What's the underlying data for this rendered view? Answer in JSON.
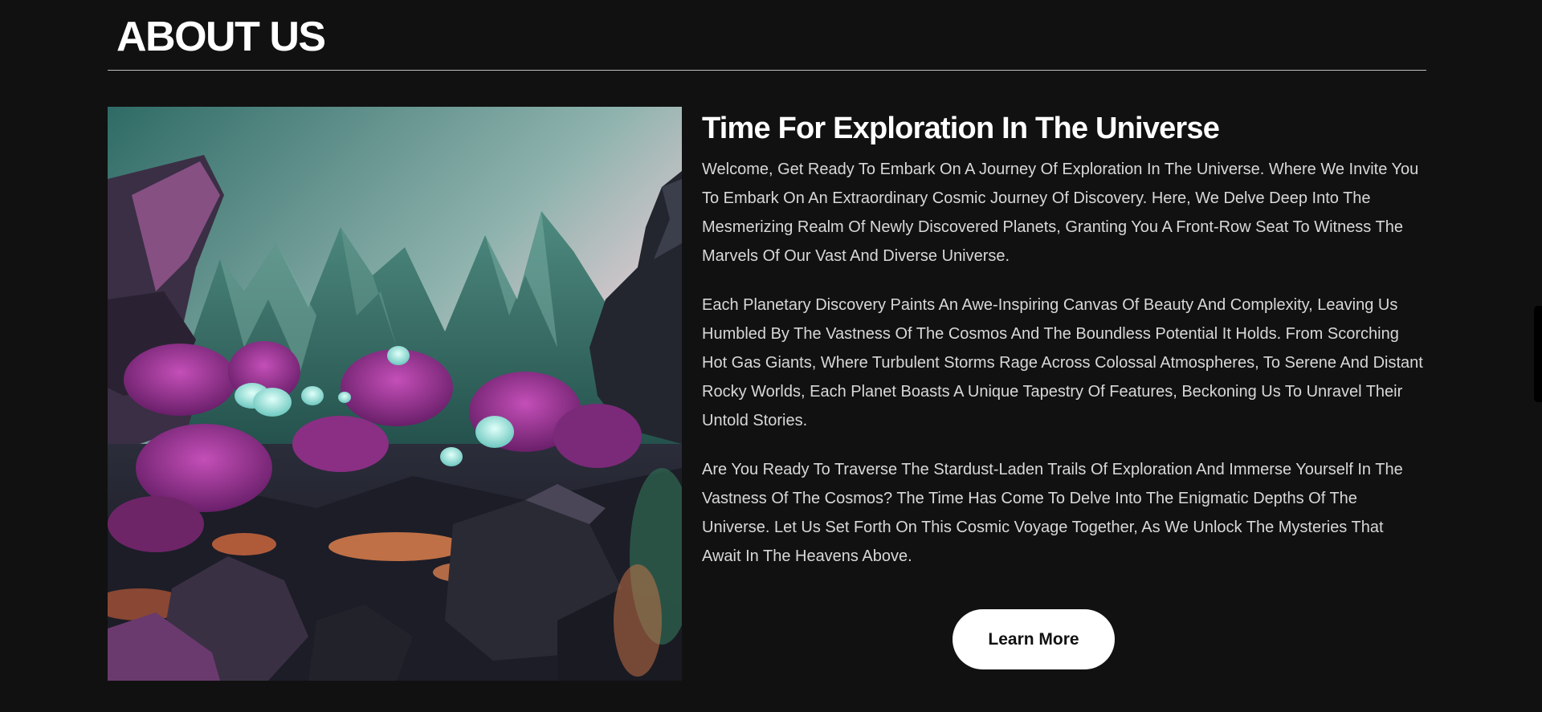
{
  "section": {
    "title": "ABOUT US"
  },
  "content": {
    "heading": "Time For Exploration In The Universe",
    "paragraphs": [
      "Welcome, Get Ready To Embark On A Journey Of Exploration In The Universe. Where We Invite You To Embark On An Extraordinary Cosmic Journey Of Discovery. Here, We Delve Deep Into The Mesmerizing Realm Of Newly Discovered Planets, Granting You A Front-Row Seat To Witness The Marvels Of Our Vast And Diverse Universe.",
      "Each Planetary Discovery Paints An Awe-Inspiring Canvas Of Beauty And Complexity, Leaving Us Humbled By The Vastness Of The Cosmos And The Boundless Potential It Holds. From Scorching Hot Gas Giants, Where Turbulent Storms Rage Across Colossal Atmospheres, To Serene And Distant Rocky Worlds, Each Planet Boasts A Unique Tapestry Of Features, Beckoning Us To Unravel Their Untold Stories.",
      "Are You Ready To Traverse The Stardust-Laden Trails Of Exploration And Immerse Yourself In The Vastness Of The Cosmos? The Time Has Come To Delve Into The Enigmatic Depths Of The Universe. Let Us Set Forth On This Cosmic Voyage Together, As We Unlock The Mysteries That Await In The Heavens Above."
    ],
    "button_label": "Learn More"
  },
  "colors": {
    "background": "#111111",
    "text": "#ffffff",
    "body_text": "#d8d8d8",
    "button_bg": "#ffffff",
    "button_text": "#111111"
  }
}
